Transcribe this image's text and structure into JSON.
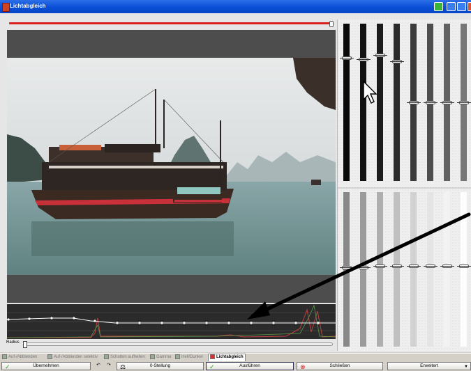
{
  "window": {
    "title": "Lichtabgleich"
  },
  "colors": {
    "titlebar": "#0a4fd6",
    "accent_red": "#d81e1e",
    "histogram_line": "#ffffff"
  },
  "sliders": {
    "top_count": 8,
    "bottom_count": 8,
    "top_levels": [
      0.22,
      0.23,
      0.2,
      0.24,
      0.5,
      0.5,
      0.5,
      0.5
    ],
    "bottom_levels": [
      0.49,
      0.49,
      0.48,
      0.48,
      0.48,
      0.48,
      0.48,
      0.48
    ]
  },
  "histogram": {
    "radius_label": "Radius"
  },
  "tabs": [
    {
      "label": "Auf-/Abblenden",
      "active": false
    },
    {
      "label": "Auf-/Abblenden selektiv",
      "active": false
    },
    {
      "label": "Schatten aufhellen",
      "active": false
    },
    {
      "label": "Gamma",
      "active": false
    },
    {
      "label": "Hell/Dunkel",
      "active": false
    },
    {
      "label": "Lichtabgleich",
      "active": true
    }
  ],
  "toolbar": {
    "apply_label": "Übernehmen",
    "zero_label": "0-Stellung",
    "execute_label": "Ausführen",
    "close_label": "Schließen",
    "advanced_label": "Erweitert"
  },
  "icons": {
    "apply": "check-icon",
    "undo": "undo-icon",
    "redo": "redo-icon",
    "zero": "scale-icon",
    "execute": "run-icon",
    "close": "close-circle-icon",
    "advanced": "chevron-down-icon"
  }
}
